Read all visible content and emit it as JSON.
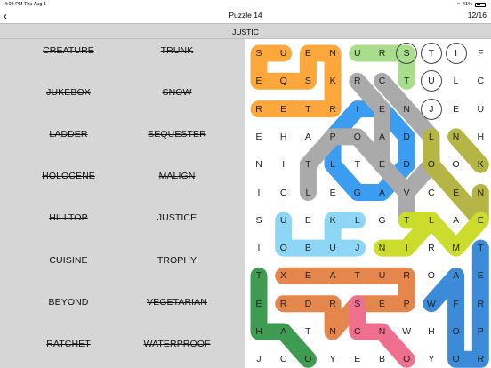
{
  "status": {
    "time": "4:03 PM",
    "day": "Thu Aug 1",
    "battery": "41%"
  },
  "header": {
    "title": "Puzzle 14",
    "counter": "12/16",
    "back_icon": "chevron-left-icon"
  },
  "current_word": "JUSTIC",
  "words": [
    {
      "text": "CREATURE",
      "found": true
    },
    {
      "text": "TRUNK",
      "found": true
    },
    {
      "text": "JUKEBOX",
      "found": true
    },
    {
      "text": "SNOW",
      "found": true
    },
    {
      "text": "LADDER",
      "found": true
    },
    {
      "text": "SEQUESTER",
      "found": true
    },
    {
      "text": "HOLOCENE",
      "found": true
    },
    {
      "text": "MALIGN",
      "found": true
    },
    {
      "text": "HILLTOP",
      "found": true
    },
    {
      "text": "JUSTICE",
      "found": false
    },
    {
      "text": "CUISINE",
      "found": false
    },
    {
      "text": "TROPHY",
      "found": false
    },
    {
      "text": "BEYOND",
      "found": false
    },
    {
      "text": "VEGETARIAN",
      "found": true
    },
    {
      "text": "RATCHET",
      "found": true
    },
    {
      "text": "WATERPROOF",
      "found": true
    }
  ],
  "grid": [
    "SUENURSTIF",
    "EQSKRCTULC",
    "RETRIENJEU",
    "EHAPOADLNH",
    "NITLTEDOOK",
    "ICLEGAVCEN",
    "SUEKLGTLAE",
    "IOBUJNIRMT",
    "TXEATUROAE",
    "ERDRSEPWFR",
    "HATNCNWHOP",
    "JCOYEBOYOR"
  ],
  "hint_cells": [
    [
      0,
      6
    ],
    [
      0,
      7
    ],
    [
      0,
      8
    ],
    [
      1,
      7
    ],
    [
      2,
      7
    ]
  ],
  "found_paths": [
    {
      "color": "#fba73c",
      "cells": [
        [
          0,
          1
        ],
        [
          0,
          0
        ],
        [
          1,
          0
        ],
        [
          1,
          1
        ],
        [
          1,
          2
        ],
        [
          0,
          2
        ],
        [
          0,
          3
        ],
        [
          1,
          3
        ],
        [
          2,
          3
        ],
        [
          2,
          2
        ],
        [
          2,
          1
        ],
        [
          2,
          0
        ]
      ]
    },
    {
      "color": "#a8dd8b",
      "cells": [
        [
          0,
          4
        ],
        [
          0,
          5
        ],
        [
          0,
          6
        ],
        [
          1,
          6
        ]
      ]
    },
    {
      "color": "#3b9df2",
      "cells": [
        [
          2,
          4
        ],
        [
          2,
          5
        ],
        [
          3,
          6
        ],
        [
          4,
          6
        ],
        [
          5,
          5
        ],
        [
          5,
          4
        ],
        [
          4,
          3
        ],
        [
          3,
          3
        ],
        [
          2,
          4
        ]
      ]
    },
    {
      "color": "#aaaaaa",
      "cells": [
        [
          1,
          5
        ],
        [
          2,
          6
        ],
        [
          3,
          7
        ],
        [
          4,
          7
        ],
        [
          5,
          6
        ],
        [
          4,
          5
        ],
        [
          3,
          4
        ],
        [
          3,
          3
        ],
        [
          4,
          2
        ],
        [
          5,
          2
        ]
      ]
    },
    {
      "color": "#aaaaaa",
      "cells": [
        [
          1,
          4
        ],
        [
          2,
          5
        ],
        [
          3,
          5
        ],
        [
          4,
          5
        ],
        [
          5,
          6
        ],
        [
          6,
          6
        ]
      ]
    },
    {
      "color": "#b5b545",
      "cells": [
        [
          5,
          9
        ],
        [
          6,
          9
        ],
        [
          5,
          8
        ],
        [
          4,
          7
        ],
        [
          3,
          7
        ]
      ]
    },
    {
      "color": "#b5b545",
      "cells": [
        [
          3,
          8
        ],
        [
          4,
          9
        ]
      ]
    },
    {
      "color": "#ccdc2c",
      "cells": [
        [
          6,
          6
        ],
        [
          6,
          7
        ],
        [
          7,
          6
        ],
        [
          7,
          5
        ]
      ]
    },
    {
      "color": "#ccdc2c",
      "cells": [
        [
          6,
          7
        ],
        [
          7,
          8
        ],
        [
          6,
          9
        ]
      ]
    },
    {
      "color": "#8ed6f6",
      "cells": [
        [
          6,
          4
        ],
        [
          6,
          3
        ],
        [
          7,
          3
        ],
        [
          7,
          4
        ],
        [
          7,
          2
        ],
        [
          7,
          1
        ],
        [
          6,
          1
        ]
      ]
    },
    {
      "color": "#3f9a52",
      "cells": [
        [
          8,
          0
        ],
        [
          9,
          0
        ],
        [
          10,
          0
        ],
        [
          10,
          1
        ],
        [
          11,
          2
        ]
      ]
    },
    {
      "color": "#e5874d",
      "cells": [
        [
          8,
          1
        ],
        [
          8,
          2
        ],
        [
          8,
          3
        ],
        [
          8,
          4
        ],
        [
          8,
          5
        ],
        [
          8,
          6
        ],
        [
          9,
          6
        ],
        [
          9,
          5
        ],
        [
          9,
          4
        ],
        [
          10,
          3
        ],
        [
          9,
          3
        ],
        [
          9,
          2
        ],
        [
          9,
          1
        ]
      ]
    },
    {
      "color": "#ef6f8f",
      "cells": [
        [
          9,
          4
        ],
        [
          10,
          4
        ],
        [
          10,
          5
        ],
        [
          11,
          6
        ]
      ]
    },
    {
      "color": "#3b8bd8",
      "cells": [
        [
          7,
          9
        ],
        [
          8,
          9
        ],
        [
          9,
          9
        ],
        [
          10,
          9
        ],
        [
          11,
          9
        ],
        [
          11,
          8
        ],
        [
          10,
          8
        ],
        [
          9,
          8
        ],
        [
          8,
          8
        ],
        [
          9,
          7
        ]
      ]
    }
  ]
}
